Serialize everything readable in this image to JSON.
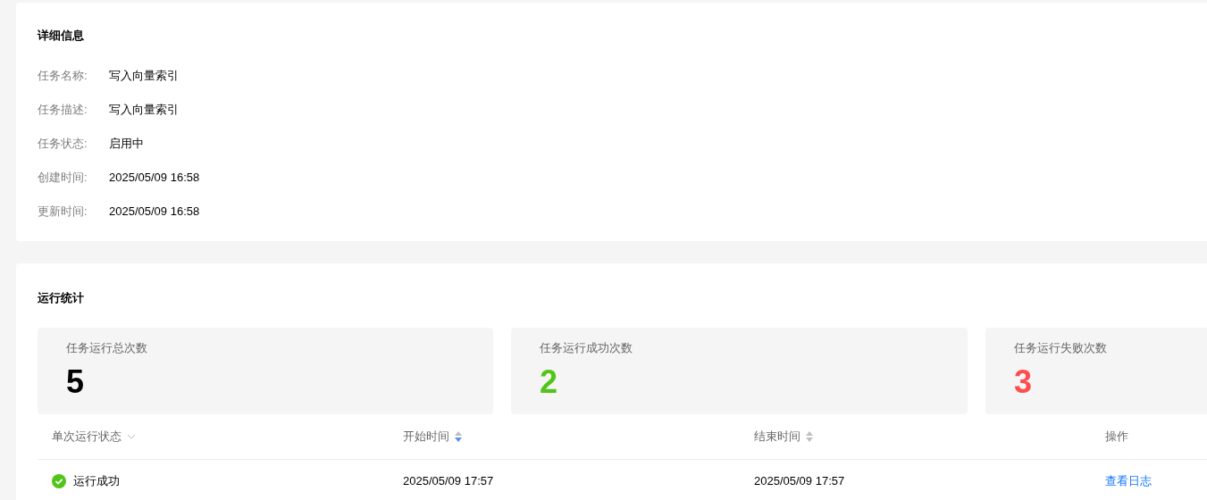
{
  "details": {
    "title": "详细信息",
    "fields": [
      {
        "label": "任务名称:",
        "value": "写入向量索引"
      },
      {
        "label": "任务描述:",
        "value": "写入向量索引"
      },
      {
        "label": "任务状态:",
        "value": "启用中"
      },
      {
        "label": "创建时间:",
        "value": "2025/05/09 16:58"
      },
      {
        "label": "更新时间:",
        "value": "2025/05/09 16:58"
      }
    ]
  },
  "stats": {
    "title": "运行统计",
    "cards": [
      {
        "label": "任务运行总次数",
        "value": "5",
        "color": "#000000"
      },
      {
        "label": "任务运行成功次数",
        "value": "2",
        "color": "#52c41a"
      },
      {
        "label": "任务运行失败次数",
        "value": "3",
        "color": "#ff4d4f"
      }
    ]
  },
  "table": {
    "columns": [
      {
        "label": "单次运行状态",
        "kind": "filter"
      },
      {
        "label": "开始时间",
        "kind": "sort",
        "sorted_descending": true
      },
      {
        "label": "结束时间",
        "kind": "sort",
        "sorted_descending": false
      },
      {
        "label": "操作",
        "kind": "plain"
      }
    ],
    "rows": [
      {
        "status": "运行成功",
        "succeeded": true,
        "start": "2025/05/09 17:57",
        "end": "2025/05/09 17:57",
        "action": "查看日志"
      }
    ]
  }
}
